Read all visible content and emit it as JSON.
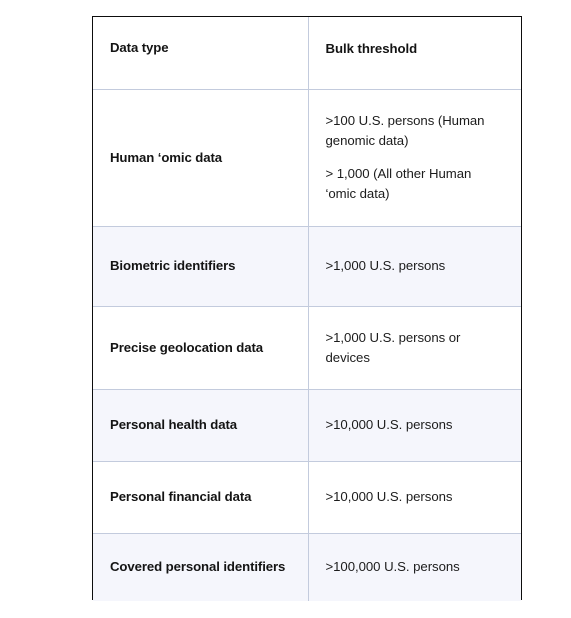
{
  "table": {
    "columns": [
      "Data type",
      "Bulk threshold"
    ],
    "rows": [
      {
        "data_type": "Human ‘omic data",
        "threshold_lines": [
          ">100 U.S. persons (Human genomic data)",
          "> 1,000 (All other Human ‘omic data)"
        ],
        "shaded": false
      },
      {
        "data_type": "Biometric identifiers",
        "threshold_lines": [
          ">1,000 U.S. persons"
        ],
        "shaded": true
      },
      {
        "data_type": "Precise geolocation data",
        "threshold_lines": [
          ">1,000 U.S. persons or devices"
        ],
        "shaded": false
      },
      {
        "data_type": "Personal health data",
        "threshold_lines": [
          ">10,000 U.S. persons"
        ],
        "shaded": true
      },
      {
        "data_type": "Personal financial data",
        "threshold_lines": [
          ">10,000 U.S. persons"
        ],
        "shaded": false
      },
      {
        "data_type": "Covered personal identifiers",
        "threshold_lines": [
          ">100,000 U.S. persons"
        ],
        "shaded": true
      }
    ]
  },
  "colors": {
    "page_background": "#ffffff",
    "outer_border": "#0d0d0d",
    "grid_line": "#c3cbdd",
    "shaded_row": "#f5f6fc",
    "header_text": "#141414",
    "body_text": "#1c1c1c"
  }
}
